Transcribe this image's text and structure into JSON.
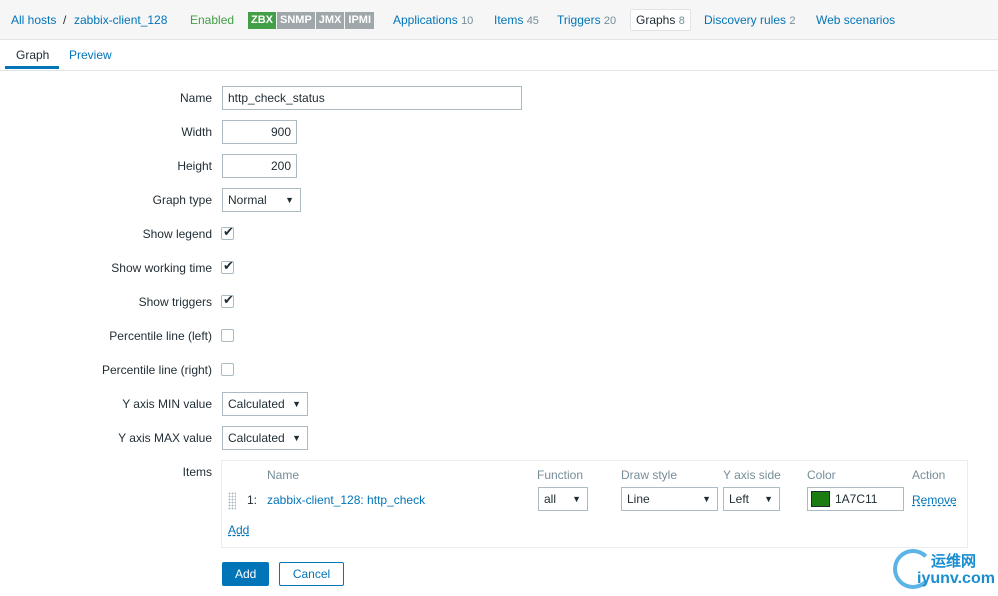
{
  "hostbar": {
    "all_hosts": "All hosts",
    "separator": "/",
    "host": "zabbix-client_128",
    "status": "Enabled",
    "availability": [
      "ZBX",
      "SNMP",
      "JMX",
      "IPMI"
    ],
    "nav": [
      {
        "label": "Applications",
        "count": "10"
      },
      {
        "label": "Items",
        "count": "45"
      },
      {
        "label": "Triggers",
        "count": "20"
      },
      {
        "label": "Graphs",
        "count": "8"
      },
      {
        "label": "Discovery rules",
        "count": "2"
      },
      {
        "label": "Web scenarios",
        "count": ""
      }
    ]
  },
  "tabs": {
    "graph": "Graph",
    "preview": "Preview"
  },
  "form": {
    "name_label": "Name",
    "name_value": "http_check_status",
    "width_label": "Width",
    "width_value": "900",
    "height_label": "Height",
    "height_value": "200",
    "graph_type_label": "Graph type",
    "graph_type_value": "Normal",
    "show_legend_label": "Show legend",
    "show_legend": true,
    "show_working_time_label": "Show working time",
    "show_working_time": true,
    "show_triggers_label": "Show triggers",
    "show_triggers": true,
    "percentile_left_label": "Percentile line (left)",
    "percentile_left": false,
    "percentile_right_label": "Percentile line (right)",
    "percentile_right": false,
    "ymin_label": "Y axis MIN value",
    "ymin_value": "Calculated",
    "ymax_label": "Y axis MAX value",
    "ymax_value": "Calculated",
    "items_label": "Items"
  },
  "items_table": {
    "headers": {
      "name": "Name",
      "function": "Function",
      "draw_style": "Draw style",
      "y_axis_side": "Y axis side",
      "color": "Color",
      "action": "Action"
    },
    "rows": [
      {
        "num": "1:",
        "name": "zabbix-client_128: http_check",
        "function": "all",
        "draw_style": "Line",
        "y_axis_side": "Left",
        "color": "1A7C11",
        "action": "Remove"
      }
    ],
    "add_label": "Add"
  },
  "buttons": {
    "add": "Add",
    "cancel": "Cancel"
  },
  "watermark": {
    "cn": "运维网",
    "en": "iyunv.com"
  },
  "colors": {
    "accent": "#0275b8",
    "enabled": "#429e47",
    "item_color": "#1A7C11"
  }
}
